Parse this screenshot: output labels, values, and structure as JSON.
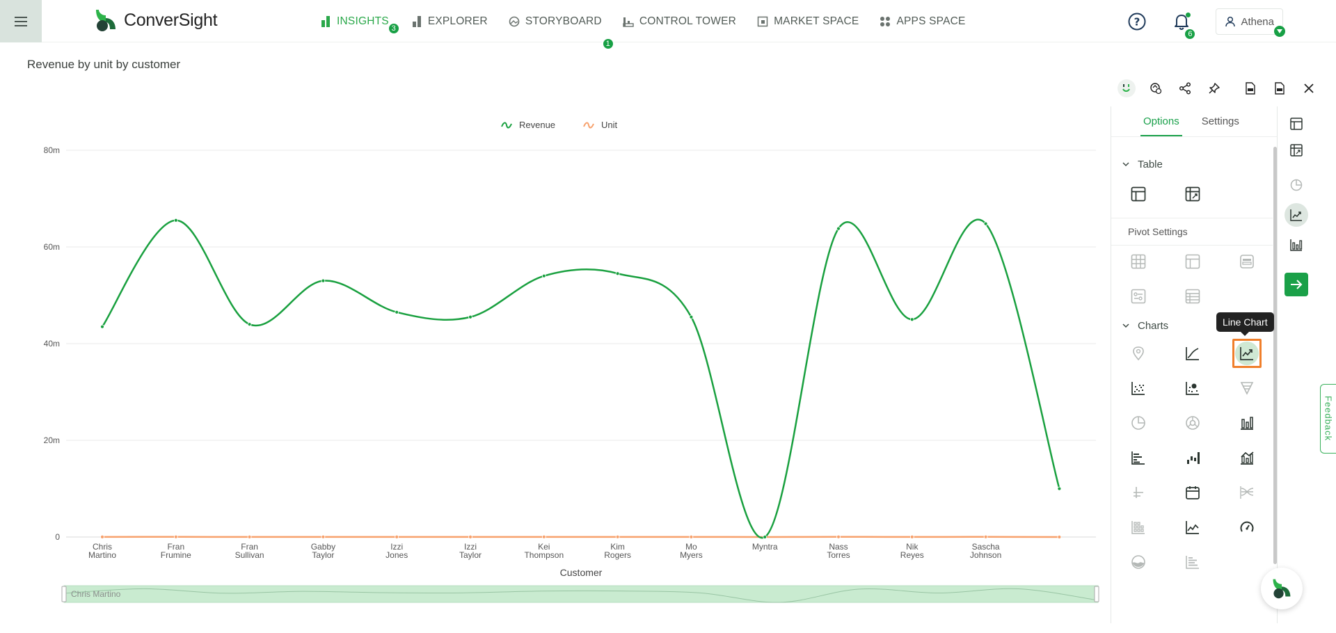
{
  "app": {
    "name": "ConverSight"
  },
  "nav": {
    "items": [
      {
        "label": "INSIGHTS",
        "icon": "insights-icon",
        "badge": "3",
        "active": true
      },
      {
        "label": "EXPLORER",
        "icon": "explorer-icon"
      },
      {
        "label": "STORYBOARD",
        "icon": "storyboard-icon",
        "badge": "1"
      },
      {
        "label": "CONTROL TOWER",
        "icon": "control-tower-icon"
      },
      {
        "label": "MARKET SPACE",
        "icon": "market-space-icon"
      },
      {
        "label": "APPS SPACE",
        "icon": "apps-space-icon"
      }
    ]
  },
  "header": {
    "notifications_count": "6",
    "user_name": "Athena"
  },
  "page": {
    "title": "Revenue by unit by customer"
  },
  "chart_data": {
    "type": "line",
    "xlabel": "Customer",
    "ylabel": "",
    "ylim": [
      0,
      80000000
    ],
    "yticks": [
      "0",
      "20m",
      "40m",
      "60m",
      "80m"
    ],
    "grid": true,
    "legend_position": "top-center",
    "categories": [
      "Chris Martino",
      "Fran Frumine",
      "Fran Sullivan",
      "Gabby Taylor",
      "Izzi Jones",
      "Izzi Taylor",
      "Kei Thompson",
      "Kim Rogers",
      "Mo Myers",
      "Myntra",
      "Nass Torres",
      "Nik Reyes",
      "Sascha Johnson",
      ""
    ],
    "series": [
      {
        "name": "Revenue",
        "color": "#19a03f",
        "values": [
          43500000,
          65500000,
          44000000,
          53000000,
          46500000,
          45500000,
          54000000,
          54500000,
          45500000,
          0,
          63800000,
          45000000,
          64800000,
          10000000
        ]
      },
      {
        "name": "Unit",
        "color": "#f7a16c",
        "values": [
          20000,
          30000,
          20000,
          25000,
          20000,
          20000,
          25000,
          25000,
          20000,
          0,
          30000,
          20000,
          30000,
          5000
        ]
      }
    ],
    "slider_label": "Chris Martino"
  },
  "panel": {
    "tabs": [
      "Options",
      "Settings"
    ],
    "active_tab": "Options",
    "sections": {
      "table": "Table",
      "pivot": "Pivot Settings",
      "charts": "Charts"
    },
    "tooltip": "Line Chart",
    "selected_chart": "line-chart"
  },
  "feedback_label": "Feedback",
  "colors": {
    "brand": "#19a04a",
    "highlight": "#f07f2b"
  }
}
